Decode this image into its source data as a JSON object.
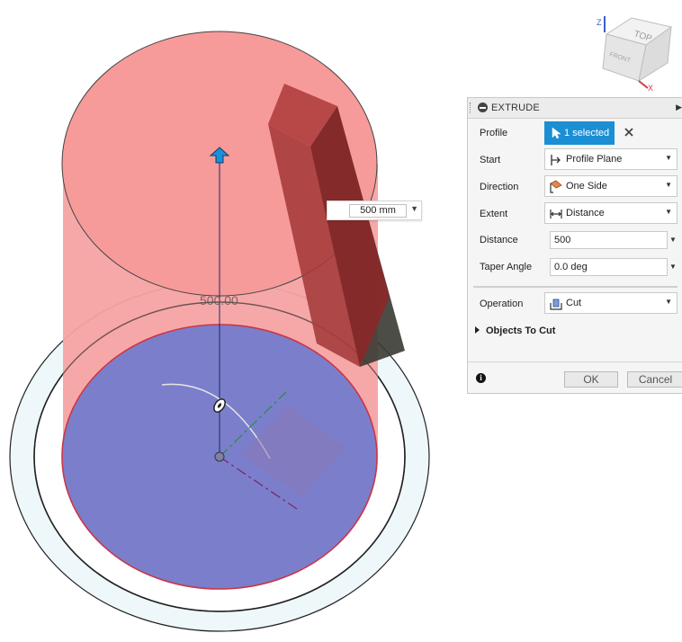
{
  "canvas": {
    "dimension_label": "500.00",
    "dimension_input": {
      "value": "500 mm"
    }
  },
  "viewcube": {
    "top_label": "TOP",
    "front_label": "FRONT",
    "axes": {
      "z": "Z",
      "x": "X"
    }
  },
  "extrude_panel": {
    "title": "EXTRUDE",
    "fields": {
      "profile": {
        "label": "Profile",
        "button_text": "1 selected"
      },
      "start": {
        "label": "Start",
        "value": "Profile Plane"
      },
      "direction": {
        "label": "Direction",
        "value": "One Side"
      },
      "extent": {
        "label": "Extent",
        "value": "Distance"
      },
      "distance": {
        "label": "Distance",
        "value": "500"
      },
      "taper_angle": {
        "label": "Taper Angle",
        "value": "0.0 deg"
      },
      "operation": {
        "label": "Operation",
        "value": "Cut"
      }
    },
    "objects_to_cut_label": "Objects To Cut",
    "ok_label": "OK",
    "cancel_label": "Cancel"
  },
  "colors": {
    "cylinder_fill": "#f59a9a",
    "profile_fill": "#7b7fcb",
    "selected_button": "#1a8fd4",
    "box_side": "#7a2a2a"
  }
}
